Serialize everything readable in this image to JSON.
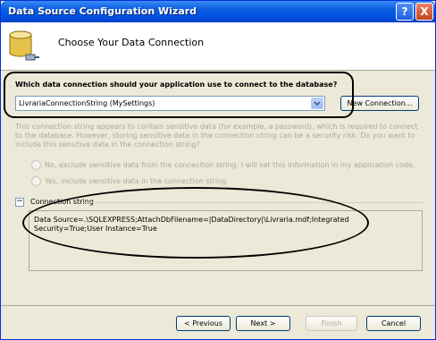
{
  "window": {
    "title": "Data Source Configuration Wizard",
    "help_glyph": "?",
    "close_glyph": "X"
  },
  "header": {
    "title": "Choose Your Data Connection"
  },
  "connection": {
    "question": "Which data connection should your application use to connect to the database?",
    "selected": "LivrariaConnectionString (MySettings)",
    "new_connection_label": "New Connection..."
  },
  "sensitive": {
    "description": "This connection string appears to contain sensitive data (for example, a password), which is required to connect to the database. However, storing sensitive data in the connection string can be a security risk. Do you want to include this sensitive data in the connection string?",
    "option_no": "No, exclude sensitive data from the connection string. I will set this information in my application code.",
    "option_yes": "Yes, include sensitive data in the connection string."
  },
  "connection_string": {
    "label": "Connection string",
    "toggle_glyph": "−",
    "value": "Data Source=.\\SQLEXPRESS;AttachDbFilename=|DataDirectory|\\Livraria.mdf;Integrated Security=True;User Instance=True"
  },
  "footer": {
    "previous_label": "< Previous",
    "next_label": "Next >",
    "finish_label": "Finish",
    "cancel_label": "Cancel"
  },
  "colors": {
    "titlebar": "#0054e3",
    "dialog_bg": "#ece9d8",
    "disabled_text": "#aca899"
  }
}
